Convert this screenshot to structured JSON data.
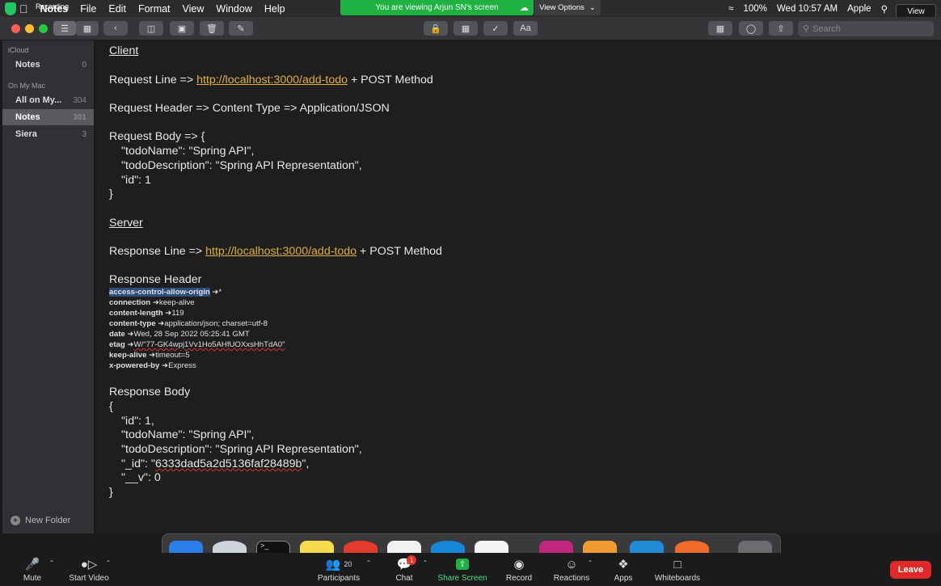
{
  "menubar": {
    "recording": "Recording",
    "items": [
      "Notes",
      "File",
      "Edit",
      "Format",
      "View",
      "Window",
      "Help"
    ],
    "viewing_banner": "You are viewing Arjun SN's screen",
    "view_options": "View Options",
    "battery": "100%",
    "datetime": "Wed 10:57 AM",
    "user": "Apple",
    "view_button": "View"
  },
  "toolbar": {
    "search_placeholder": "Search"
  },
  "sidebar": {
    "icloud_header": "iCloud",
    "icloud_notes_label": "Notes",
    "icloud_notes_count": "0",
    "mac_header": "On My Mac",
    "items": [
      {
        "label": "All on My...",
        "count": "304"
      },
      {
        "label": "Notes",
        "count": "301"
      },
      {
        "label": "Siera",
        "count": "3"
      }
    ],
    "new_folder": "New Folder"
  },
  "note": {
    "client_heading": "Client",
    "req_line_prefix": "Request Line => ",
    "req_line_url": "http://localhost:3000/add-todo",
    "req_line_suffix": " + POST Method",
    "req_header": "Request Header => Content Type => Application/JSON",
    "req_body_open": "Request Body => {",
    "req_body_lines": [
      "\"todoName\": \"Spring API\",",
      "\"todoDescription\": \"Spring API Representation\",",
      "\"id\": 1"
    ],
    "req_body_close": "}",
    "server_heading": "Server",
    "resp_line_prefix": "Response Line => ",
    "resp_line_url": "http://localhost:3000/add-todo",
    "resp_line_suffix": " + POST Method",
    "resp_header_title": "Response Header",
    "resp_headers": [
      {
        "key": "access-control-allow-origin",
        "value": "*"
      },
      {
        "key": "connection",
        "value": "keep-alive"
      },
      {
        "key": "content-length",
        "value": "119"
      },
      {
        "key": "content-type",
        "value": "application/json; charset=utf-8"
      },
      {
        "key": "date",
        "value": "Wed, 28 Sep 2022 05:25:41 GMT"
      },
      {
        "key": "etag",
        "value": "W/\"77-GK4wpj1Vv1Ho5AHfUOXxsHhTdA0\""
      },
      {
        "key": "keep-alive",
        "value": "timeout=5"
      },
      {
        "key": "x-powered-by",
        "value": "Express"
      }
    ],
    "resp_body_title": "Response Body",
    "resp_body_open": "{",
    "resp_body_line1": "\"id\": 1,",
    "resp_body_line2": "\"todoName\": \"Spring API\",",
    "resp_body_line3": "\"todoDescription\": \"Spring API Representation\",",
    "resp_body_id_prefix": "\"_id\": \"",
    "resp_body_id_value": "6333dad5a2d5136faf28489b",
    "resp_body_id_suffix": "\",",
    "resp_body_v": "\"__v\": 0",
    "resp_body_close": "}"
  },
  "zoom": {
    "mute": "Mute",
    "start_video": "Start Video",
    "participants": "Participants",
    "participants_count": "20",
    "chat": "Chat",
    "chat_badge": "1",
    "share_screen": "Share Screen",
    "record": "Record",
    "reactions": "Reactions",
    "apps": "Apps",
    "whiteboards": "Whiteboards",
    "leave": "Leave"
  }
}
